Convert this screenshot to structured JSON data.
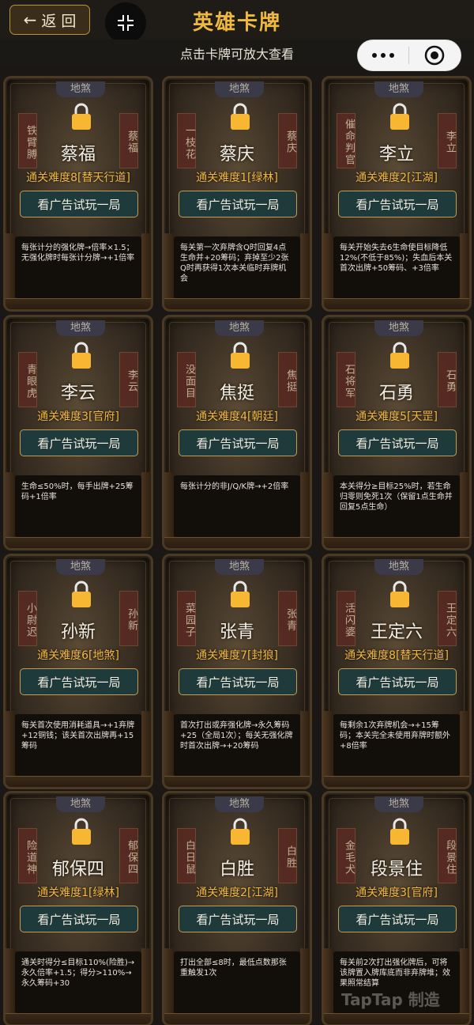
{
  "header": {
    "back_label": "返 回",
    "title": "英雄卡牌",
    "hint": "点击卡牌可放大查看"
  },
  "icons": {
    "back": "left-arrow-icon",
    "collapse": "collapse-icon",
    "more": "more-dots-icon",
    "close": "target-close-icon",
    "lock": "lock-icon"
  },
  "colors": {
    "title": "#f0b83c",
    "difficulty": "#f2b840",
    "button_bg": "#1f3a3a",
    "button_border": "#c29c52",
    "lock": "#f7b733"
  },
  "card_tag": "地煞",
  "button_label": "看广告试玩一局",
  "cards": [
    {
      "name": "蔡福",
      "banner_left": "铁臂膊",
      "banner_right": "蔡福",
      "difficulty": "通关难度8[替天行道]",
      "desc": "每张计分的强化牌→倍率×1.5；无强化牌时每张计分牌→+1倍率"
    },
    {
      "name": "蔡庆",
      "banner_left": "一枝花",
      "banner_right": "蔡庆",
      "difficulty": "通关难度1[绿林]",
      "desc": "每关第一次弃牌含Q时回复4点生命并+20筹码；弃掉至少2张Q时再获得1次本关临时弃牌机会"
    },
    {
      "name": "李立",
      "banner_left": "催命判官",
      "banner_right": "李立",
      "difficulty": "通关难度2[江湖]",
      "desc": "每关开始失去6生命使目标降低12%(不低于85%)；失血后本关首次出牌+50筹码、+3倍率"
    },
    {
      "name": "李云",
      "banner_left": "青眼虎",
      "banner_right": "李云",
      "difficulty": "通关难度3[官府]",
      "desc": "生命≤50%时，每手出牌+25筹码+1倍率"
    },
    {
      "name": "焦挺",
      "banner_left": "没面目",
      "banner_right": "焦挺",
      "difficulty": "通关难度4[朝廷]",
      "desc": "每张计分的非J/Q/K牌→+2倍率"
    },
    {
      "name": "石勇",
      "banner_left": "石将军",
      "banner_right": "石勇",
      "difficulty": "通关难度5[天罡]",
      "desc": "本关得分≥目标25%时，若生命归零则免死1次（保留1点生命并回复5点生命）"
    },
    {
      "name": "孙新",
      "banner_left": "小尉迟",
      "banner_right": "孙新",
      "difficulty": "通关难度6[地煞]",
      "desc": "每关首次使用消耗道具→+1弃牌+12铜钱；该关首次出牌再+15筹码"
    },
    {
      "name": "张青",
      "banner_left": "菜园子",
      "banner_right": "张青",
      "difficulty": "通关难度7[封狼]",
      "desc": "首次打出或弃强化牌→永久筹码+25（全局1次）；每关无强化牌时首次出牌→+20筹码"
    },
    {
      "name": "王定六",
      "banner_left": "活闪婆",
      "banner_right": "王定六",
      "difficulty": "通关难度8[替天行道]",
      "desc": "每剩余1次弃牌机会→+15筹码；本关完全未使用弃牌时额外+8倍率"
    },
    {
      "name": "郁保四",
      "banner_left": "险道神",
      "banner_right": "郁保四",
      "difficulty": "通关难度1[绿林]",
      "desc": "通关时得分≤目标110%(险胜)→永久倍率+1.5；得分>110%→永久筹码+30"
    },
    {
      "name": "白胜",
      "banner_left": "白日鼠",
      "banner_right": "白胜",
      "difficulty": "通关难度2[江湖]",
      "desc": "打出全部≤8时，最低点数那张重触发1次"
    },
    {
      "name": "段景住",
      "banner_left": "金毛犬",
      "banner_right": "段景住",
      "difficulty": "通关难度3[官府]",
      "desc": "每关前2次打出强化牌后，可将该牌置入牌库底而非弃牌堆；效果照常结算"
    }
  ],
  "watermark": "TapTap 制造"
}
